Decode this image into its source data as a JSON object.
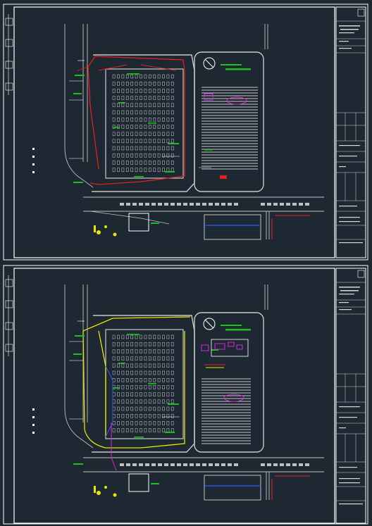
{
  "sheets": [
    {
      "id": "sheet-1",
      "title_block": {
        "rows": [
          "",
          "",
          "",
          "",
          "",
          "",
          "",
          "",
          ""
        ]
      }
    },
    {
      "id": "sheet-2",
      "title_block": {
        "rows": [
          "",
          "",
          "",
          "",
          "",
          "",
          "",
          "",
          ""
        ]
      }
    }
  ],
  "colors": {
    "background": "#1e2832",
    "frame": "#ffffff",
    "road": "#bfbfbf",
    "grid": "#c8c8c8",
    "red_line": "#e02020",
    "yellow_line": "#e6e600",
    "green_tag": "#18c218",
    "magenta": "#e020e0",
    "cyan": "#20c8e8",
    "blue": "#2f59ff"
  }
}
